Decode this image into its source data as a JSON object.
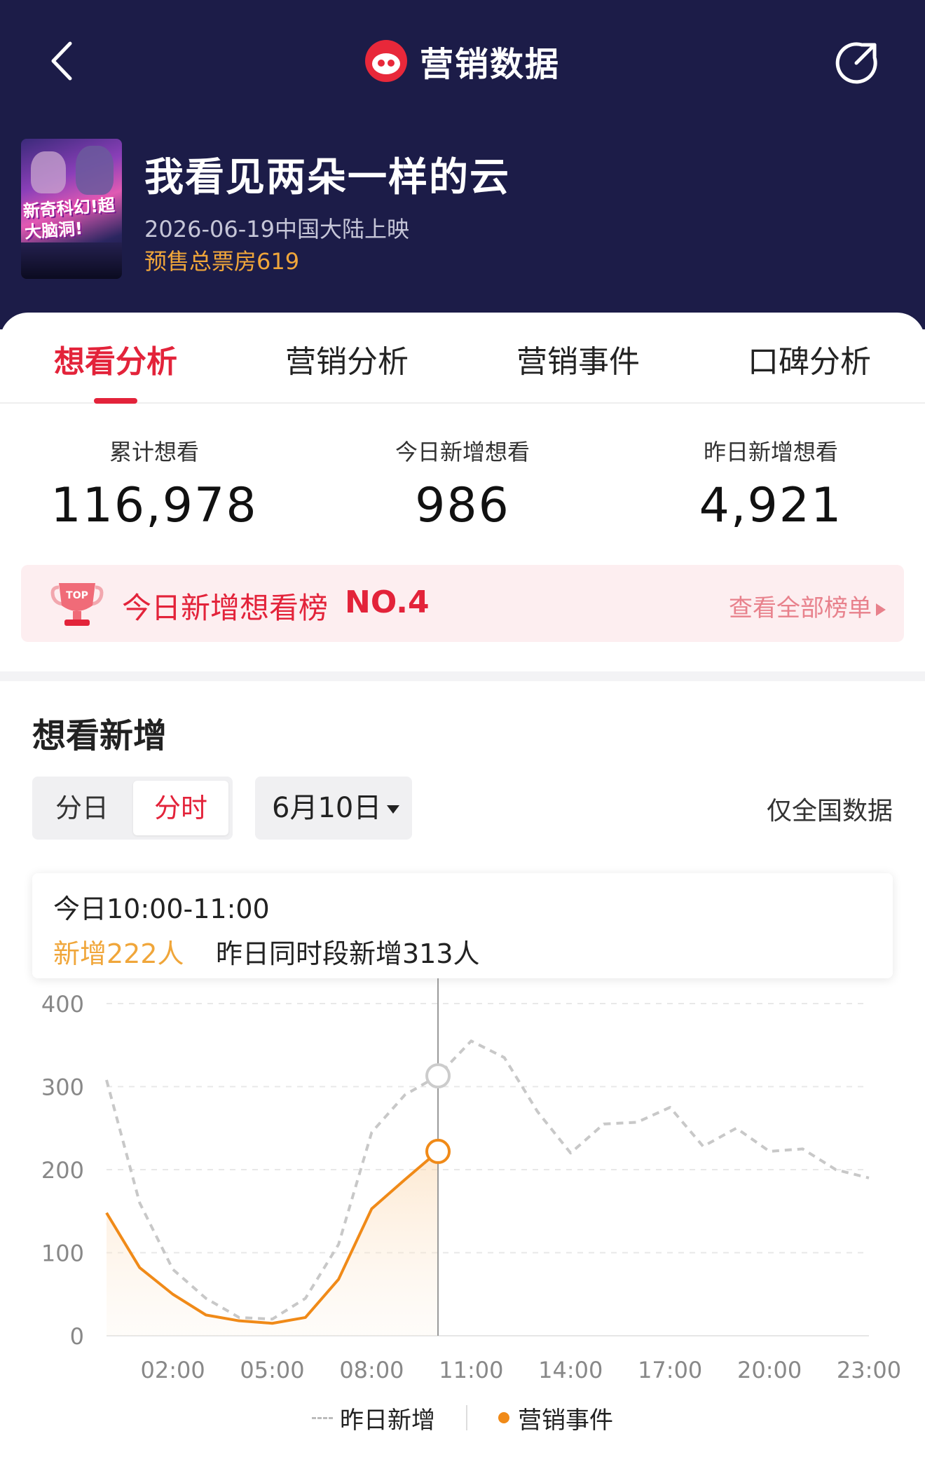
{
  "header": {
    "title": "营销数据",
    "colors": {
      "background": "#1c1c48",
      "accent": "#e3233a"
    },
    "icons": {
      "back": "back-arrow-icon",
      "logo": "cat-logo-icon",
      "share": "share-icon"
    }
  },
  "movie": {
    "title": "我看见两朵一样的云",
    "release": "2026-06-19中国大陆上映",
    "presale": "预售总票房619",
    "poster_text": "新奇科幻!超大脑洞!"
  },
  "tabs": [
    {
      "label": "想看分析",
      "active": true
    },
    {
      "label": "营销分析",
      "active": false
    },
    {
      "label": "营销事件",
      "active": false
    },
    {
      "label": "口碑分析",
      "active": false
    }
  ],
  "stats": [
    {
      "label": "累计想看",
      "value": "116,978"
    },
    {
      "label": "今日新增想看",
      "value": "986"
    },
    {
      "label": "昨日新增想看",
      "value": "4,921"
    }
  ],
  "ranking": {
    "badge": "TOP",
    "label": "今日新增想看榜",
    "rank": "NO.4",
    "link": "查看全部榜单"
  },
  "section": {
    "title": "想看新增",
    "segment": {
      "day": "分日",
      "hour": "分时",
      "selected": "分时"
    },
    "date": "6月10日",
    "nationwide": "仅全国数据"
  },
  "tooltip": {
    "time": "今日10:00-11:00",
    "new_today": "新增222人",
    "yesterday": "昨日同时段新增313人"
  },
  "chart_data": {
    "type": "line",
    "x": [
      "00:00",
      "01:00",
      "02:00",
      "03:00",
      "04:00",
      "05:00",
      "06:00",
      "07:00",
      "08:00",
      "09:00",
      "10:00",
      "11:00",
      "12:00",
      "13:00",
      "14:00",
      "15:00",
      "16:00",
      "17:00",
      "18:00",
      "19:00",
      "20:00",
      "21:00",
      "22:00",
      "23:00"
    ],
    "x_ticks": [
      "02:00",
      "05:00",
      "08:00",
      "11:00",
      "14:00",
      "17:00",
      "20:00",
      "23:00"
    ],
    "y_ticks": [
      "0",
      "100",
      "200",
      "300",
      "400"
    ],
    "ylim": [
      0,
      400
    ],
    "series": [
      {
        "name": "昨日新增",
        "style": "dashed",
        "color": "#c8c8c8",
        "values": [
          308,
          160,
          80,
          45,
          22,
          20,
          45,
          110,
          245,
          290,
          313,
          355,
          335,
          270,
          220,
          255,
          257,
          275,
          228,
          250,
          222,
          225,
          200,
          190
        ]
      },
      {
        "name": "营销事件",
        "style": "solid",
        "color": "#f08a18",
        "values": [
          148,
          82,
          50,
          25,
          18,
          15,
          22,
          68,
          153,
          188,
          222
        ]
      }
    ],
    "highlight_index": 10,
    "grid": true
  },
  "legend": {
    "yesterday": "昨日新增",
    "events": "营销事件"
  }
}
